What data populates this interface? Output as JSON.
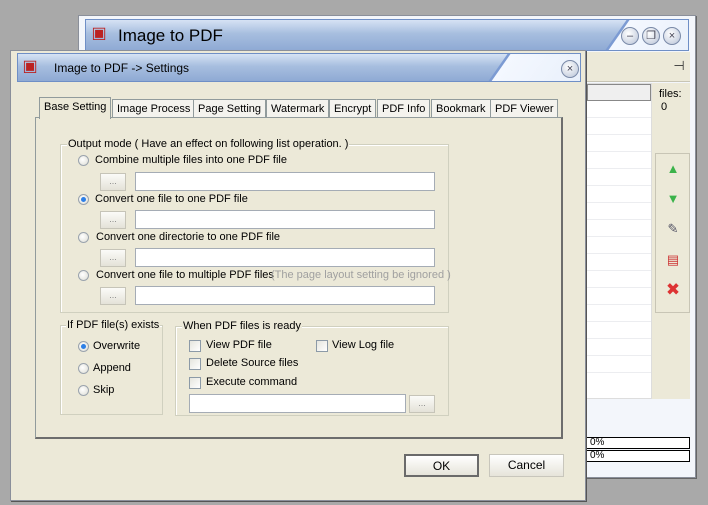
{
  "main_window": {
    "title": "Image to PDF",
    "files_label": "files:",
    "files_count": "0",
    "progress": [
      "0%",
      "0%"
    ],
    "side_buttons": [
      "move-up",
      "move-down",
      "edit",
      "remove",
      "clear"
    ]
  },
  "dialog": {
    "title": "Image to PDF -> Settings",
    "tabs": [
      "Base Setting",
      "Image Process",
      "Page Setting",
      "Watermark",
      "Encrypt",
      "PDF Info",
      "Bookmark",
      "PDF Viewer"
    ],
    "output_mode": {
      "legend": "Output mode  ( Have an  effect on following list operation. )",
      "options": [
        {
          "label": "Combine multiple files into one PDF file",
          "selected": false,
          "value": ""
        },
        {
          "label": "Convert one file to one PDF file",
          "selected": true,
          "value": ""
        },
        {
          "label": "Convert one directorie to one PDF file",
          "selected": false,
          "value": ""
        },
        {
          "label": "Convert one file to multiple PDF files",
          "selected": false,
          "value": "",
          "note": "(The page layout setting be ignored )"
        }
      ],
      "browse_label": "..."
    },
    "if_exists": {
      "legend": "If PDF file(s) exists",
      "options": [
        {
          "label": "Overwrite",
          "selected": true
        },
        {
          "label": "Append",
          "selected": false
        },
        {
          "label": "Skip",
          "selected": false
        }
      ]
    },
    "when_ready": {
      "legend": "When PDF files is ready",
      "view_pdf": "View PDF file",
      "view_log": "View Log file",
      "delete_source": "Delete Source files",
      "execute_command": "Execute command",
      "command_value": "",
      "browse_label": "..."
    },
    "ok_label": "OK",
    "cancel_label": "Cancel"
  }
}
